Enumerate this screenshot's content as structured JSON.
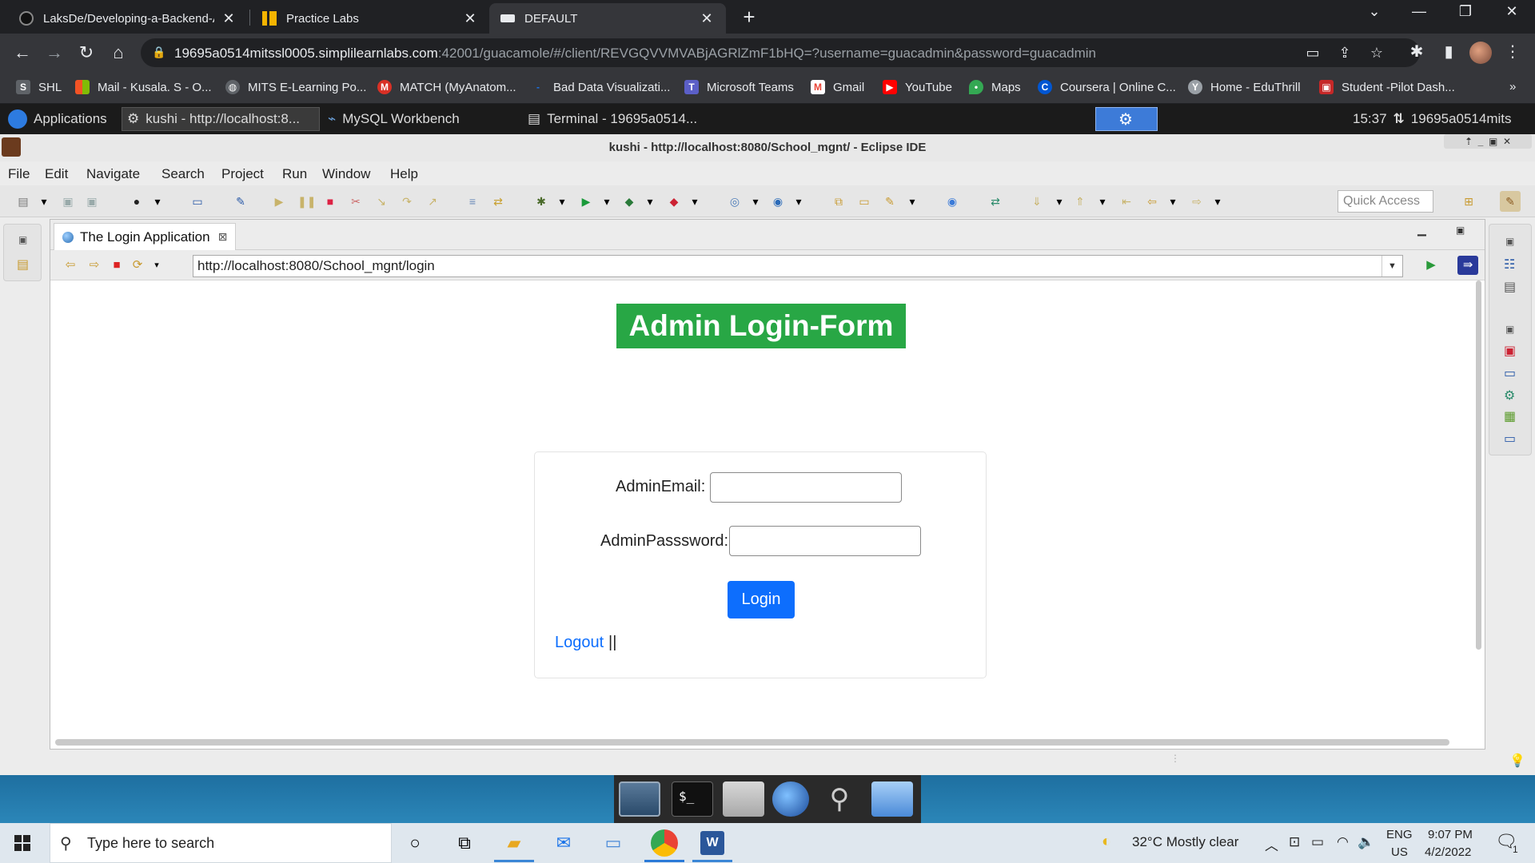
{
  "browser": {
    "tabs": [
      {
        "label": "LaksDe/Developing-a-Backend-A",
        "active": false
      },
      {
        "label": "Practice Labs",
        "active": false
      },
      {
        "label": "DEFAULT",
        "active": true
      }
    ],
    "url_host": "19695a0514mitssl0005.simplilearnlabs.com",
    "url_rest": ":42001/guacamole/#/client/REVGQVVMVABjAGRlZmF1bHQ=?username=guacadmin&password=guacadmin",
    "bookmarks": [
      {
        "label": "SHL",
        "icon": "shl-icon",
        "color": "#5f6368"
      },
      {
        "label": "Mail - Kusala. S - O...",
        "icon": "microsoft-icon",
        "color": "#f35325"
      },
      {
        "label": "MITS E-Learning Po...",
        "icon": "globe-icon",
        "color": "#5f6368"
      },
      {
        "label": "MATCH (MyAnatom...",
        "icon": "match-icon",
        "color": "#d93025"
      },
      {
        "label": "Bad Data Visualizati...",
        "icon": "dash-icon",
        "color": "#1a73e8"
      },
      {
        "label": "Microsoft Teams",
        "icon": "teams-icon",
        "color": "#5b5fc7"
      },
      {
        "label": "Gmail",
        "icon": "gmail-icon",
        "color": "#ea4335"
      },
      {
        "label": "YouTube",
        "icon": "youtube-icon",
        "color": "#ff0000"
      },
      {
        "label": "Maps",
        "icon": "maps-icon",
        "color": "#34a853"
      },
      {
        "label": "Coursera | Online C...",
        "icon": "coursera-icon",
        "color": "#0056d2"
      },
      {
        "label": "Home - EduThrill",
        "icon": "edu-icon",
        "color": "#9aa0a6"
      },
      {
        "label": "Student -Pilot Dash...",
        "icon": "student-icon",
        "color": "#c62828"
      }
    ]
  },
  "remote_panel": {
    "applications": "Applications",
    "windows": [
      "kushi - http://localhost:8...",
      "MySQL Workbench",
      "Terminal - 19695a0514..."
    ],
    "time": "15:37",
    "user": "19695a0514mits"
  },
  "eclipse": {
    "title": "kushi - http://localhost:8080/School_mgnt/ - Eclipse IDE",
    "menu": [
      "File",
      "Edit",
      "Navigate",
      "Search",
      "Project",
      "Run",
      "Window",
      "Help"
    ],
    "quick_access": "Quick Access",
    "editor_tab": "The Login Application",
    "browser_url": "http://localhost:8080/School_mgnt/login"
  },
  "page": {
    "heading": "Admin Login-Form",
    "email_label": "AdminEmail:",
    "password_label": "AdminPasssword:",
    "login_button": "Login",
    "logout_link": "Logout",
    "separator": "||",
    "accent_green": "#28a745",
    "accent_blue": "#0d6efd"
  },
  "taskbar": {
    "search_placeholder": "Type here to search",
    "weather": "32°C  Mostly clear",
    "lang": "ENG",
    "region": "US",
    "time": "9:07 PM",
    "date": "4/2/2022",
    "notifications": "1"
  }
}
